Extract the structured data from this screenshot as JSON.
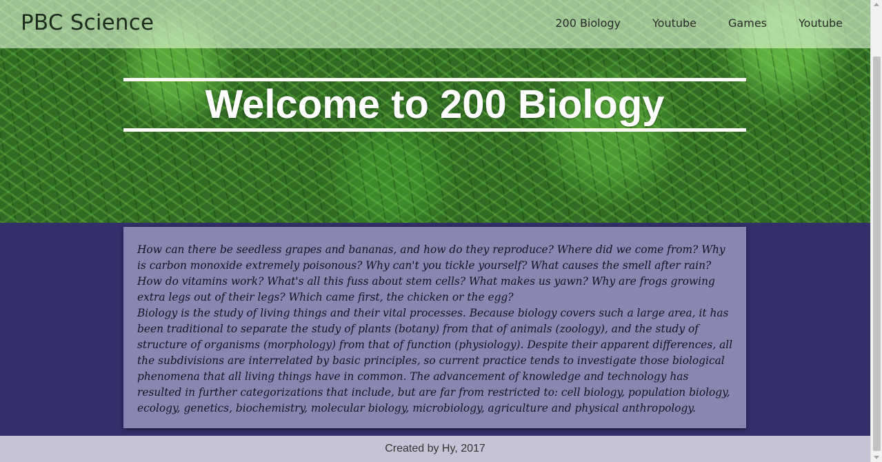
{
  "navbar": {
    "brand": "PBC Science",
    "links": [
      "200 Biology",
      "Youtube",
      "Games",
      "Youtube"
    ]
  },
  "hero": {
    "title": "Welcome to 200 Biology"
  },
  "content": {
    "questions": "How can there be seedless grapes and bananas, and how do they reproduce? Where did we come from? Why is carbon monoxide extremely poisonous? Why can't you tickle yourself? What causes the smell after rain? How do vitamins work? What's all this fuss about stem cells? What makes us yawn? Why are frogs growing extra legs out of their legs? Which came first, the chicken or the egg?",
    "description": "Biology is the study of living things and their vital processes. Because biology covers such a large area, it has been traditional to separate the study of plants (botany) from that of animals (zoology), and the study of structure of organisms (morphology) from that of function (physiology). Despite their apparent differences, all the subdivisions are interrelated by basic principles, so current practice tends to investigate those biological phenomena that all living things have in common. The advancement of knowledge and technology has resulted in further categorizations that include, but are far from restricted to: cell biology, population biology, ecology, genetics, biochemistry, molecular biology, microbiology, agriculture and physical anthropology."
  },
  "footer": {
    "text": "Created by Hy, 2017"
  },
  "colors": {
    "page_background": "#342e6a",
    "card_background": "#8987b2",
    "footer_background": "#c5c4d6",
    "navbar_overlay": "#e1f5d7"
  }
}
